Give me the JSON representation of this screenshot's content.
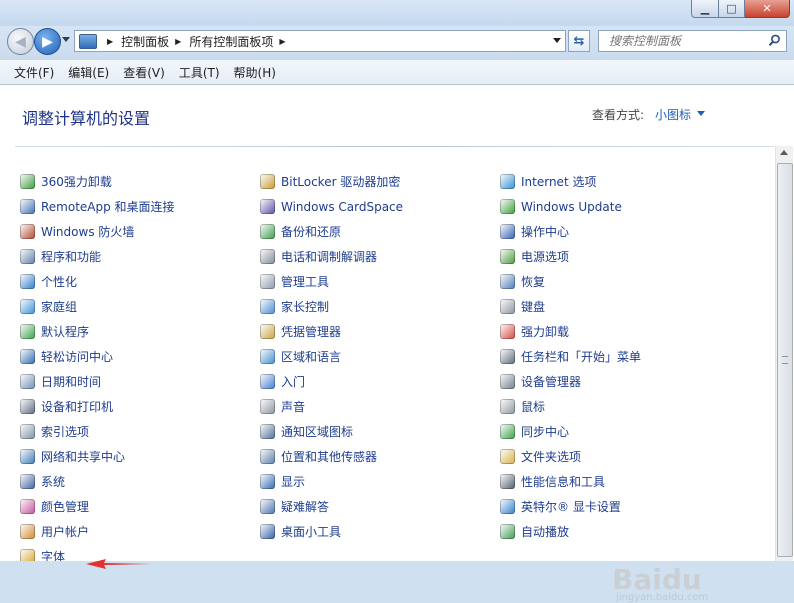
{
  "window": {
    "min_glyph": "▁",
    "max_glyph": "□",
    "close_glyph": "✕"
  },
  "nav": {
    "breadcrumbs": [
      "控制面板",
      "所有控制面板项"
    ],
    "search_placeholder": "搜索控制面板"
  },
  "menu": [
    "文件(F)",
    "编辑(E)",
    "查看(V)",
    "工具(T)",
    "帮助(H)"
  ],
  "header": {
    "title": "调整计算机的设置",
    "view_by_label": "查看方式:",
    "view_by_value": "小图标"
  },
  "columns": [
    [
      {
        "label": "360强力卸载",
        "icon": "360-uninstall-icon",
        "color": "#3a9a3a"
      },
      {
        "label": "RemoteApp 和桌面连接",
        "icon": "remoteapp-icon",
        "color": "#3d6fb6"
      },
      {
        "label": "Windows 防火墙",
        "icon": "firewall-icon",
        "color": "#b5472e"
      },
      {
        "label": "程序和功能",
        "icon": "programs-icon",
        "color": "#5d7fa8"
      },
      {
        "label": "个性化",
        "icon": "personalization-icon",
        "color": "#2d7ac9"
      },
      {
        "label": "家庭组",
        "icon": "homegroup-icon",
        "color": "#3a8fd6"
      },
      {
        "label": "默认程序",
        "icon": "default-programs-icon",
        "color": "#3aa04a"
      },
      {
        "label": "轻松访问中心",
        "icon": "ease-of-access-icon",
        "color": "#2f6bb0"
      },
      {
        "label": "日期和时间",
        "icon": "date-time-icon",
        "color": "#6c8fb5"
      },
      {
        "label": "设备和打印机",
        "icon": "devices-printers-icon",
        "color": "#5b6c80"
      },
      {
        "label": "索引选项",
        "icon": "indexing-icon",
        "color": "#7d8ea2"
      },
      {
        "label": "网络和共享中心",
        "icon": "network-sharing-icon",
        "color": "#3d78b8"
      },
      {
        "label": "系统",
        "icon": "system-icon",
        "color": "#3c5fa0"
      },
      {
        "label": "颜色管理",
        "icon": "color-management-icon",
        "color": "#c64f9c"
      },
      {
        "label": "用户帐户",
        "icon": "user-accounts-icon",
        "color": "#d08a2e"
      },
      {
        "label": "字体",
        "icon": "fonts-icon",
        "color": "#d7a430"
      }
    ],
    [
      {
        "label": "BitLocker 驱动器加密",
        "icon": "bitlocker-icon",
        "color": "#c99a2e"
      },
      {
        "label": "Windows CardSpace",
        "icon": "cardspace-icon",
        "color": "#5a4fa8"
      },
      {
        "label": "备份和还原",
        "icon": "backup-restore-icon",
        "color": "#3a9a4a"
      },
      {
        "label": "电话和调制解调器",
        "icon": "phone-modem-icon",
        "color": "#7f8893"
      },
      {
        "label": "管理工具",
        "icon": "admin-tools-icon",
        "color": "#8a97a8"
      },
      {
        "label": "家长控制",
        "icon": "parental-controls-icon",
        "color": "#4a8ad0"
      },
      {
        "label": "凭据管理器",
        "icon": "credential-manager-icon",
        "color": "#c9a23a"
      },
      {
        "label": "区域和语言",
        "icon": "region-language-icon",
        "color": "#3d8fcf"
      },
      {
        "label": "入门",
        "icon": "getting-started-icon",
        "color": "#3f7bd0"
      },
      {
        "label": "声音",
        "icon": "sound-icon",
        "color": "#8a949f"
      },
      {
        "label": "通知区域图标",
        "icon": "notification-icons-icon",
        "color": "#4d6d96"
      },
      {
        "label": "位置和其他传感器",
        "icon": "location-sensors-icon",
        "color": "#5a7da8"
      },
      {
        "label": "显示",
        "icon": "display-icon",
        "color": "#2f68b5"
      },
      {
        "label": "疑难解答",
        "icon": "troubleshooting-icon",
        "color": "#4a72b0"
      },
      {
        "label": "桌面小工具",
        "icon": "desktop-gadgets-icon",
        "color": "#2e5fa3"
      }
    ],
    [
      {
        "label": "Internet 选项",
        "icon": "internet-options-icon",
        "color": "#2f8fd4"
      },
      {
        "label": "Windows Update",
        "icon": "windows-update-icon",
        "color": "#3aa03a"
      },
      {
        "label": "操作中心",
        "icon": "action-center-icon",
        "color": "#2f5fb2"
      },
      {
        "label": "电源选项",
        "icon": "power-options-icon",
        "color": "#4a9a3a"
      },
      {
        "label": "恢复",
        "icon": "recovery-icon",
        "color": "#4b7ab8"
      },
      {
        "label": "键盘",
        "icon": "keyboard-icon",
        "color": "#8b939c"
      },
      {
        "label": "强力卸载",
        "icon": "force-uninstall-icon",
        "color": "#d3463a"
      },
      {
        "label": "任务栏和「开始」菜单",
        "icon": "taskbar-start-menu-icon",
        "color": "#5d6a78"
      },
      {
        "label": "设备管理器",
        "icon": "device-manager-icon",
        "color": "#6f7b88"
      },
      {
        "label": "鼠标",
        "icon": "mouse-icon",
        "color": "#8c96a0"
      },
      {
        "label": "同步中心",
        "icon": "sync-center-icon",
        "color": "#39a048"
      },
      {
        "label": "文件夹选项",
        "icon": "folder-options-icon",
        "color": "#d6b24a"
      },
      {
        "label": "性能信息和工具",
        "icon": "performance-icon",
        "color": "#4f5c6a"
      },
      {
        "label": "英特尔® 显卡设置",
        "icon": "intel-graphics-icon",
        "color": "#2f7fc8"
      },
      {
        "label": "自动播放",
        "icon": "autoplay-icon",
        "color": "#3f9a55"
      }
    ]
  ],
  "watermark": {
    "brand": "Baidu",
    "site": "jingyan.baidu.com"
  }
}
